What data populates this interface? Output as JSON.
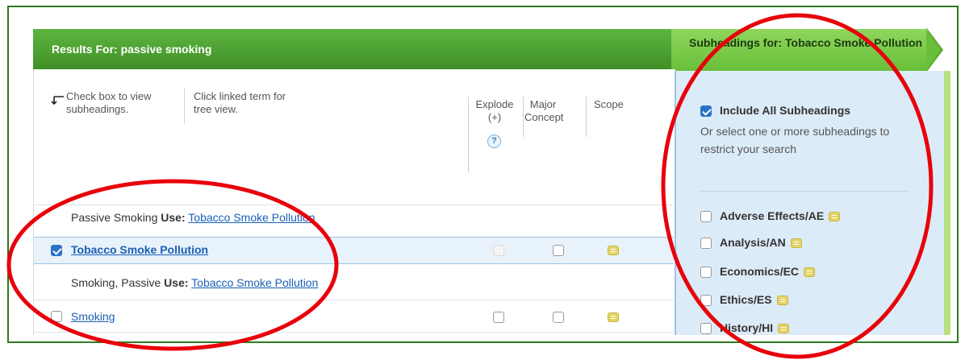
{
  "results": {
    "header": "Results For: passive smoking",
    "instructions": {
      "check_box": "Check box to view subheadings.",
      "click_term": "Click linked term for tree view."
    },
    "columns": {
      "explode": "Explode (+)",
      "major": "Major Concept",
      "scope": "Scope",
      "help": "?"
    },
    "rows": [
      {
        "prefix": "Passive Smoking ",
        "use": "Use:",
        "term": "Tobacco Smoke Pollution"
      },
      {
        "term": "Tobacco Smoke Pollution"
      },
      {
        "prefix": "Smoking, Passive ",
        "use": "Use:",
        "term": "Tobacco Smoke Pollution"
      },
      {
        "term": "Smoking"
      }
    ]
  },
  "subheadings": {
    "header": "Subheadings for: Tobacco Smoke Pollution",
    "include_all": "Include All Subheadings",
    "instructions": "Or select one or more subheadings to restrict your search",
    "items": [
      {
        "label": "Adverse Effects/AE"
      },
      {
        "label": "Analysis/AN"
      },
      {
        "label": "Economics/EC"
      },
      {
        "label": "Ethics/ES"
      },
      {
        "label": "History/HI"
      }
    ]
  },
  "colors": {
    "header_green": "#4fa433",
    "accent_blue": "#2a72c8",
    "annotation_red": "#e8000b",
    "frame_green": "#2f7a1e"
  },
  "icons": [
    "arrow-left-icon",
    "help-icon",
    "scope-note-icon",
    "checkbox-icon"
  ]
}
